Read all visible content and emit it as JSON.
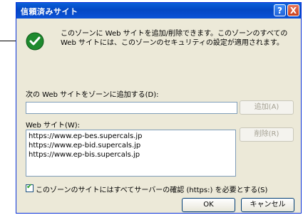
{
  "dialog": {
    "title": "信頼済みサイト",
    "help_label": "?",
    "close_label": "X",
    "description": "このゾーンに Web サイトを追加/削除できます。このゾーンのすべての Web サイトには、このゾーンのセキュリティの設定が適用されます。"
  },
  "add_section": {
    "label": "次の Web サイトをゾーンに追加する(D):",
    "input_value": "",
    "add_button": "追加(A)"
  },
  "sites_section": {
    "label": "Web サイト(W):",
    "sites": [
      "https://www.ep-bes.supercals.jp",
      "https://www.ep-bid.supercals.jp",
      "https://www.ep-bis.supercals.jp"
    ],
    "remove_button": "削除(R)"
  },
  "require_https": {
    "checked": true,
    "label": "このゾーンのサイトにはすべてサーバーの確認 (https:) を必要とする(S)"
  },
  "footer": {
    "ok_button": "OK",
    "cancel_button": "キャンセル"
  }
}
